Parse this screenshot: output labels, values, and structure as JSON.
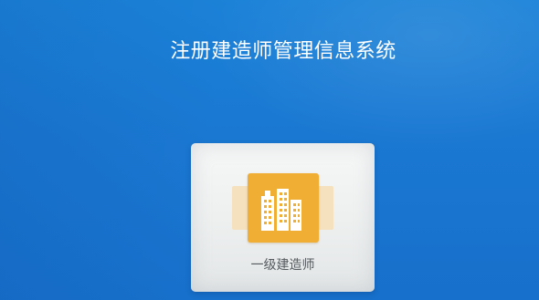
{
  "header": {
    "title": "注册建造师管理信息系统"
  },
  "roles": [
    {
      "label": "一级建造师",
      "icon": "buildings-icon"
    }
  ],
  "colors": {
    "background": "#1a78d2",
    "card": "#eef0f0",
    "icon_tile": "#f0ae34",
    "icon_wing": "#f5e1bd"
  }
}
